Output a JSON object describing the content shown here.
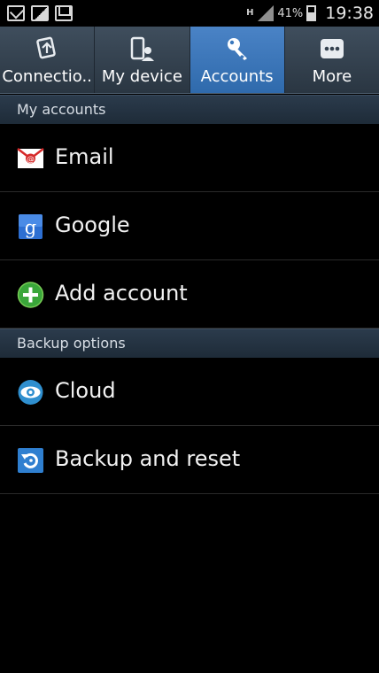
{
  "status_bar": {
    "network": "H",
    "battery": "41%",
    "time": "19:38"
  },
  "tabs": [
    {
      "label": "Connectio..",
      "icon": "connections-icon",
      "active": false
    },
    {
      "label": "My device",
      "icon": "my-device-icon",
      "active": false
    },
    {
      "label": "Accounts",
      "icon": "accounts-key-icon",
      "active": true
    },
    {
      "label": "More",
      "icon": "more-dots-icon",
      "active": false
    }
  ],
  "sections": {
    "my_accounts": {
      "title": "My accounts",
      "items": [
        {
          "label": "Email",
          "icon": "email-icon"
        },
        {
          "label": "Google",
          "icon": "google-icon"
        },
        {
          "label": "Add account",
          "icon": "add-icon"
        }
      ]
    },
    "backup_options": {
      "title": "Backup options",
      "items": [
        {
          "label": "Cloud",
          "icon": "cloud-icon"
        },
        {
          "label": "Backup and reset",
          "icon": "backup-reset-icon"
        }
      ]
    }
  },
  "colors": {
    "active_tab": "#3a78bd",
    "tab_bar": "#35424f",
    "section_header": "#24323f",
    "background": "#000000"
  }
}
